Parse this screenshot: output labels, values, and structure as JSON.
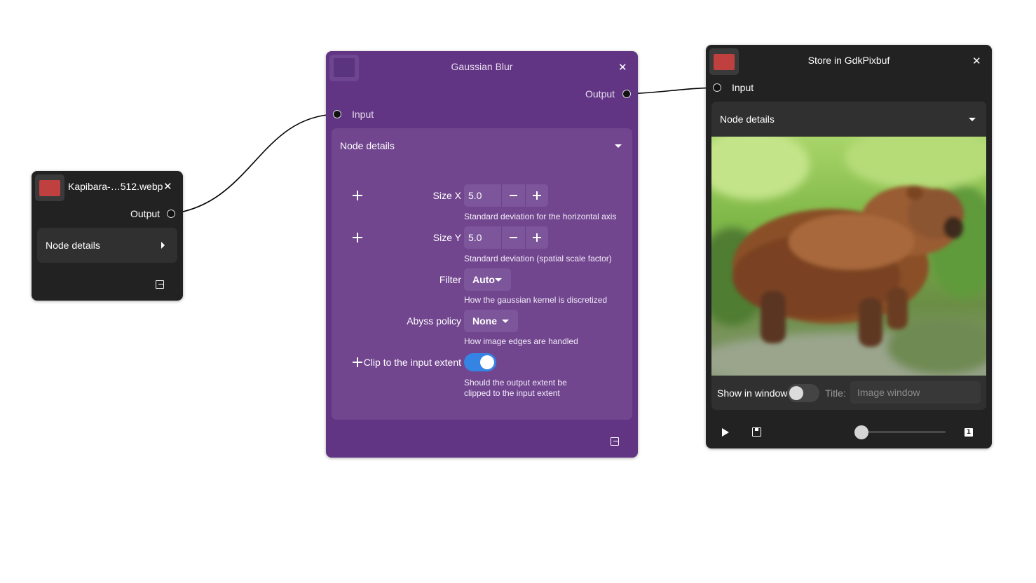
{
  "colors": {
    "canvas_background": "#ffffff",
    "node_dark": "#222222",
    "node_purple": "#613583",
    "details_purple": "#71468f",
    "accent_red": "#c0403f",
    "switch_on": "#3584e4"
  },
  "source_node": {
    "title": "Kapibara-…512.webp",
    "close_icon": "✕",
    "output_label": "Output",
    "details_title": "Node details",
    "details_state": "collapsed",
    "swatch_color": "#c0403f"
  },
  "blur_node": {
    "title": "Gaussian Blur",
    "close_icon": "✕",
    "output_label": "Output",
    "input_label": "Input",
    "details_title": "Node details",
    "details_state": "expanded",
    "size_x": {
      "label": "Size X",
      "value": "5.0",
      "description": "Standard deviation for the horizontal axis"
    },
    "size_y": {
      "label": "Size Y",
      "value": "5.0",
      "description": "Standard deviation (spatial scale factor)"
    },
    "filter": {
      "label": "Filter",
      "value": "Auto",
      "description": "How the gaussian kernel is discretized"
    },
    "abyss_policy": {
      "label": "Abyss policy",
      "value": "None",
      "description": "How image edges are handled"
    },
    "clip": {
      "label": "Clip to the input extent",
      "enabled": true,
      "description_line1": "Should the output extent be",
      "description_line2": "clipped to the input extent"
    }
  },
  "store_node": {
    "title": "Store in GdkPixbuf",
    "close_icon": "✕",
    "input_label": "Input",
    "details_title": "Node details",
    "details_state": "expanded",
    "swatch_color": "#c0403f",
    "show_in_window_label": "Show in window",
    "show_in_window": false,
    "title_label": "Title:",
    "title_placeholder": "Image window",
    "slider_value": 0,
    "page_badge": "1"
  }
}
